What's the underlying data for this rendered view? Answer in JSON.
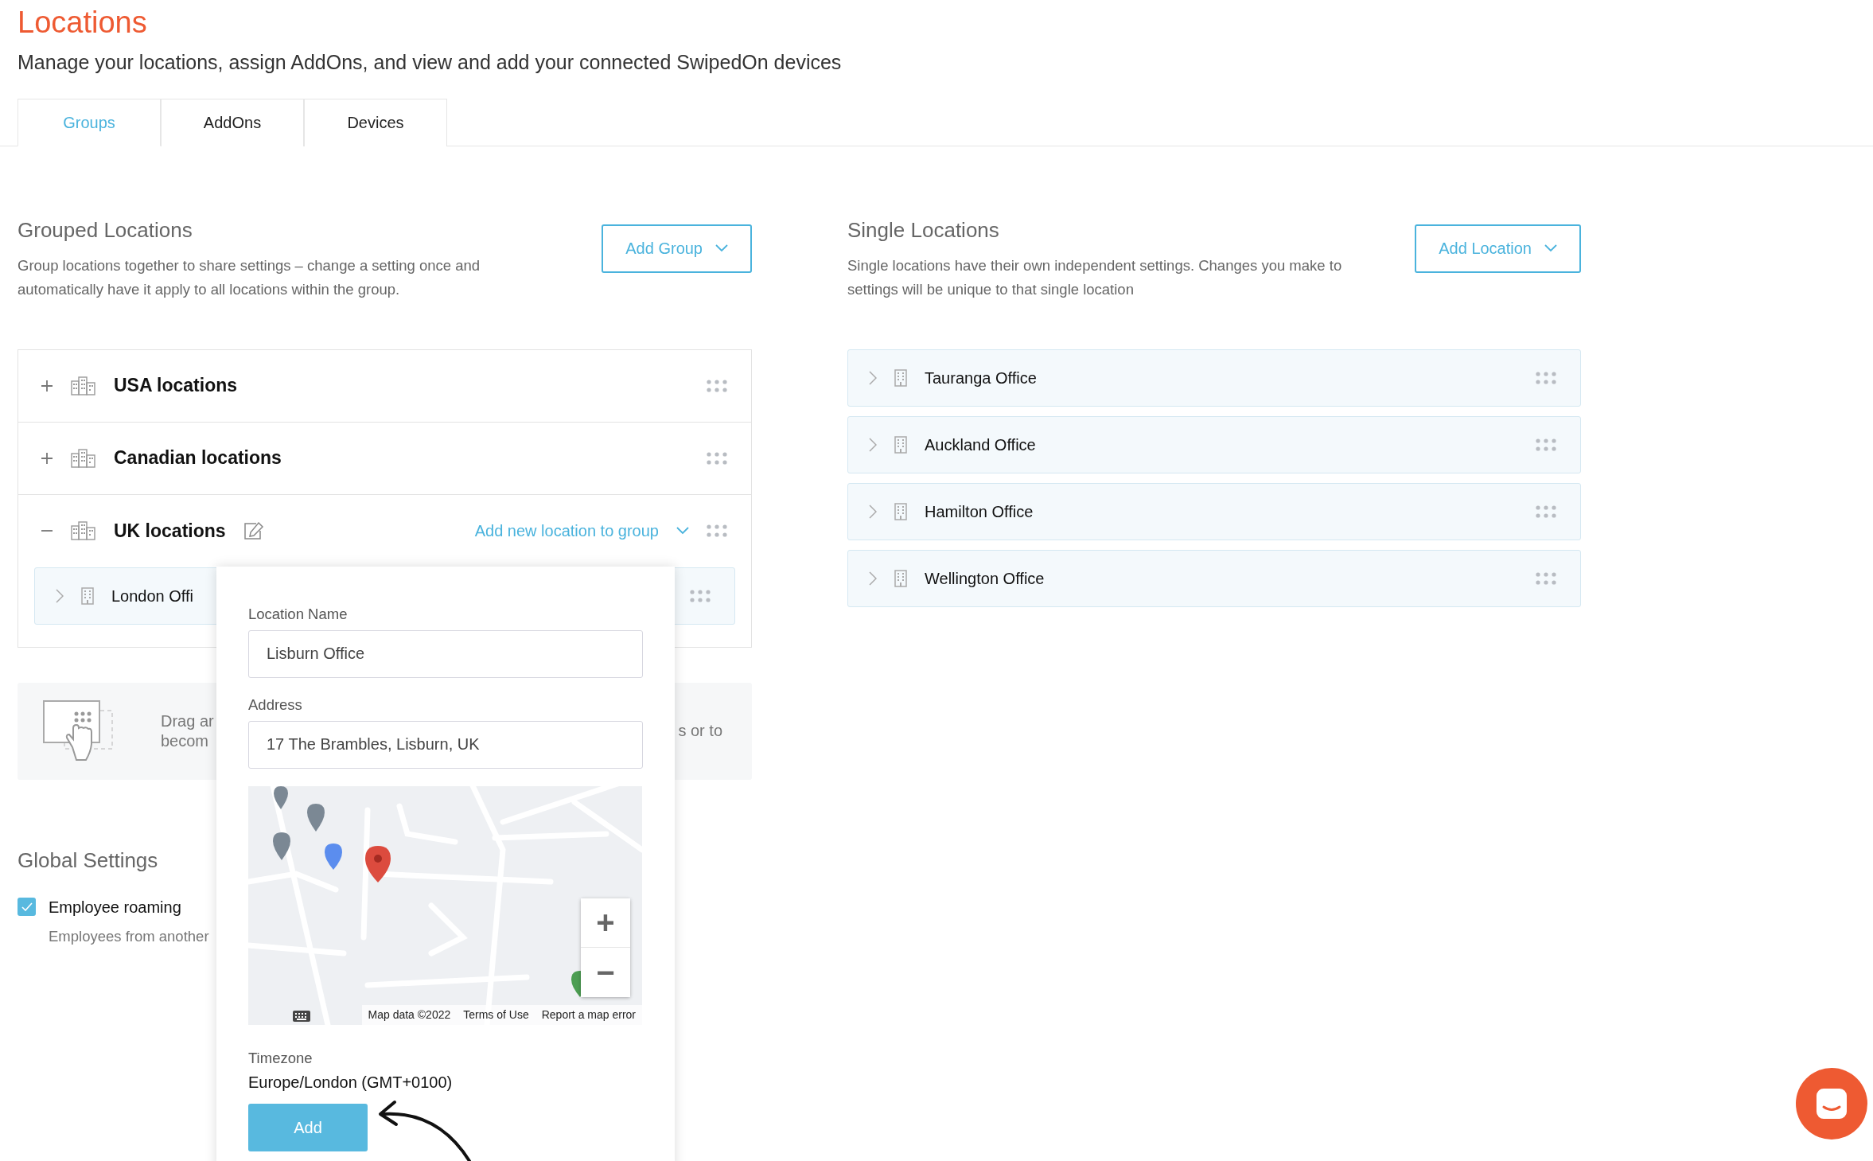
{
  "page": {
    "title": "Locations",
    "subtitle": "Manage your locations, assign AddOns, and view and add your connected SwipedOn devices"
  },
  "tabs": [
    {
      "label": "Groups",
      "selected": true
    },
    {
      "label": "AddOns",
      "selected": false
    },
    {
      "label": "Devices",
      "selected": false
    }
  ],
  "grouped": {
    "title": "Grouped Locations",
    "description": "Group locations together to share settings – change a setting once and automatically have it apply to all locations within the group.",
    "button": "Add Group",
    "groups": [
      {
        "name": "USA locations",
        "expanded": false
      },
      {
        "name": "Canadian locations",
        "expanded": false
      },
      {
        "name": "UK locations",
        "expanded": true,
        "action": "Add new location to group",
        "children": [
          {
            "name": "London Offi"
          }
        ]
      }
    ],
    "hint": {
      "lines": [
        "Drag ar",
        "becom"
      ],
      "tail": "s or to"
    }
  },
  "single": {
    "title": "Single Locations",
    "description": "Single locations have their own independent settings. Changes you make to settings will be unique to that single location",
    "button": "Add Location",
    "locations": [
      {
        "name": "Tauranga Office"
      },
      {
        "name": "Auckland Office"
      },
      {
        "name": "Hamilton Office"
      },
      {
        "name": "Wellington Office"
      }
    ]
  },
  "global": {
    "title": "Global Settings",
    "settings": [
      {
        "label": "Employee roaming",
        "checked": true,
        "description": "Employees from another"
      }
    ]
  },
  "popup": {
    "fields": [
      {
        "label": "Location Name",
        "value": "Lisburn Office"
      },
      {
        "label": "Address",
        "value": "17 The Brambles, Lisburn, UK"
      }
    ],
    "map": {
      "attribution": [
        "Map data ©2022",
        "Terms of Use",
        "Report a map error"
      ],
      "zoom_in": "+",
      "zoom_out": "−"
    },
    "timezone_label": "Timezone",
    "timezone": "Europe/London (GMT+0100)",
    "button": "Add"
  }
}
